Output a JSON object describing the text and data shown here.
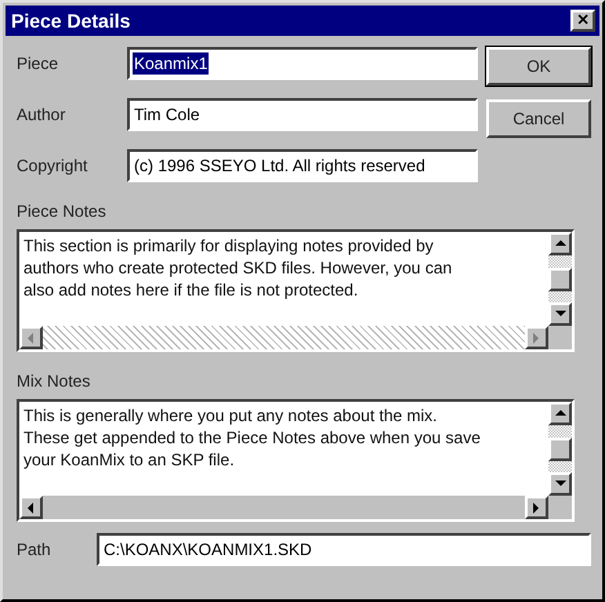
{
  "window": {
    "title": "Piece Details",
    "close": "✕"
  },
  "fields": [
    {
      "label": "Piece",
      "value": "Koanmix1",
      "selected": true
    },
    {
      "label": "Author",
      "value": "Tim Cole",
      "selected": false
    },
    {
      "label": "Copyright",
      "value": "(c) 1996 SSEYO Ltd.  All rights reserved",
      "selected": false
    }
  ],
  "buttons": [
    {
      "label": "OK",
      "default": true
    },
    {
      "label": "Cancel",
      "default": false
    }
  ],
  "notes": [
    {
      "label": "Piece Notes",
      "lines": [
        "This section is primarily for displaying notes provided by",
        "authors who create protected SKD files. However, you can",
        "also add notes here if the file is not protected."
      ],
      "hscroll_disabled": true
    },
    {
      "label": "Mix Notes",
      "lines": [
        "This is generally where you  put any notes about the mix.",
        "These get appended to the Piece Notes above when you save",
        "your KoanMix to an SKP file."
      ],
      "hscroll_disabled": false
    }
  ],
  "path": {
    "label": "Path",
    "value": "C:\\KOANX\\KOANMIX1.SKD"
  }
}
